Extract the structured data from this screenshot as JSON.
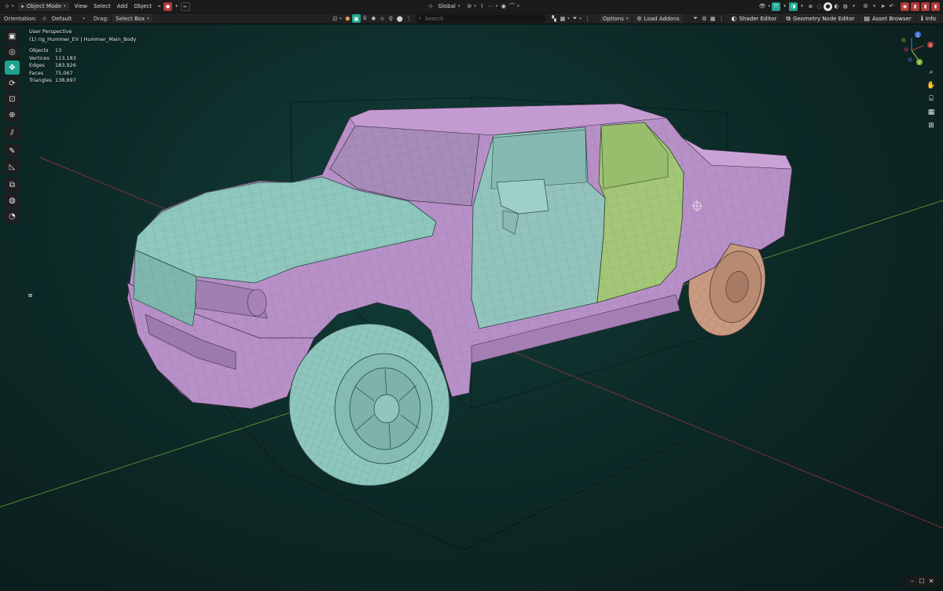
{
  "header": {
    "editor_icon": "3d-viewport-icon",
    "mode": "Object Mode",
    "menus": [
      "View",
      "Select",
      "Add",
      "Object"
    ],
    "transform_orientation": "Global",
    "search_placeholder": "Search",
    "options_label": "Options",
    "load_addons_label": "Load Addons",
    "workspace_tabs": [
      {
        "icon": "shader-icon",
        "label": "Shader Editor"
      },
      {
        "icon": "node-icon",
        "label": "Geometry Node Editor"
      },
      {
        "icon": "asset-icon",
        "label": "Asset Browser"
      },
      {
        "icon": "info-icon",
        "label": "Info"
      }
    ]
  },
  "tool_settings": {
    "orientation_label": "Orientation:",
    "orientation_value": "Default",
    "drag_label": "Drag:",
    "drag_value": "Select Box"
  },
  "viewport": {
    "view_name": "User Perspective",
    "object_path": "(1) rig_Hummer_EV | Hummer_Main_Body",
    "stats": [
      {
        "label": "Objects",
        "value": "13"
      },
      {
        "label": "Vertices",
        "value": "113,183"
      },
      {
        "label": "Edges",
        "value": "183,926"
      },
      {
        "label": "Faces",
        "value": "75,067"
      },
      {
        "label": "Triangles",
        "value": "138,697"
      }
    ]
  },
  "gizmo": {
    "x_label": "X",
    "y_label": "Y",
    "z_label": "Z"
  },
  "toolbar": [
    {
      "name": "select-box-tool",
      "icon": "▣",
      "active": false
    },
    {
      "name": "cursor-tool",
      "icon": "◎",
      "active": false
    },
    {
      "name": "move-tool",
      "icon": "✥",
      "active": true
    },
    {
      "name": "rotate-tool",
      "icon": "⟳",
      "active": false
    },
    {
      "name": "scale-tool",
      "icon": "⊡",
      "active": false
    },
    {
      "name": "transform-tool",
      "icon": "⊕",
      "active": false
    },
    {
      "name": "annotate-tool",
      "icon": "⫽",
      "active": false
    },
    {
      "name": "draw-tool",
      "icon": "✎",
      "active": false
    },
    {
      "name": "measure-tool",
      "icon": "◺",
      "active": false
    },
    {
      "name": "add-cube-tool",
      "icon": "⧉",
      "active": false
    },
    {
      "name": "add-tool",
      "icon": "◍",
      "active": false
    },
    {
      "name": "extra-tool",
      "icon": "◔",
      "active": false
    }
  ],
  "colors": {
    "accent": "#1fa38f",
    "body_purple": "#b890c8",
    "panel_teal": "#8ec7bd",
    "door_green": "#a3c777",
    "wheel_orange": "#c79a80",
    "axis_x": "#b0373d",
    "axis_y": "#7ab43a",
    "axis_z": "#3b6fd6"
  }
}
